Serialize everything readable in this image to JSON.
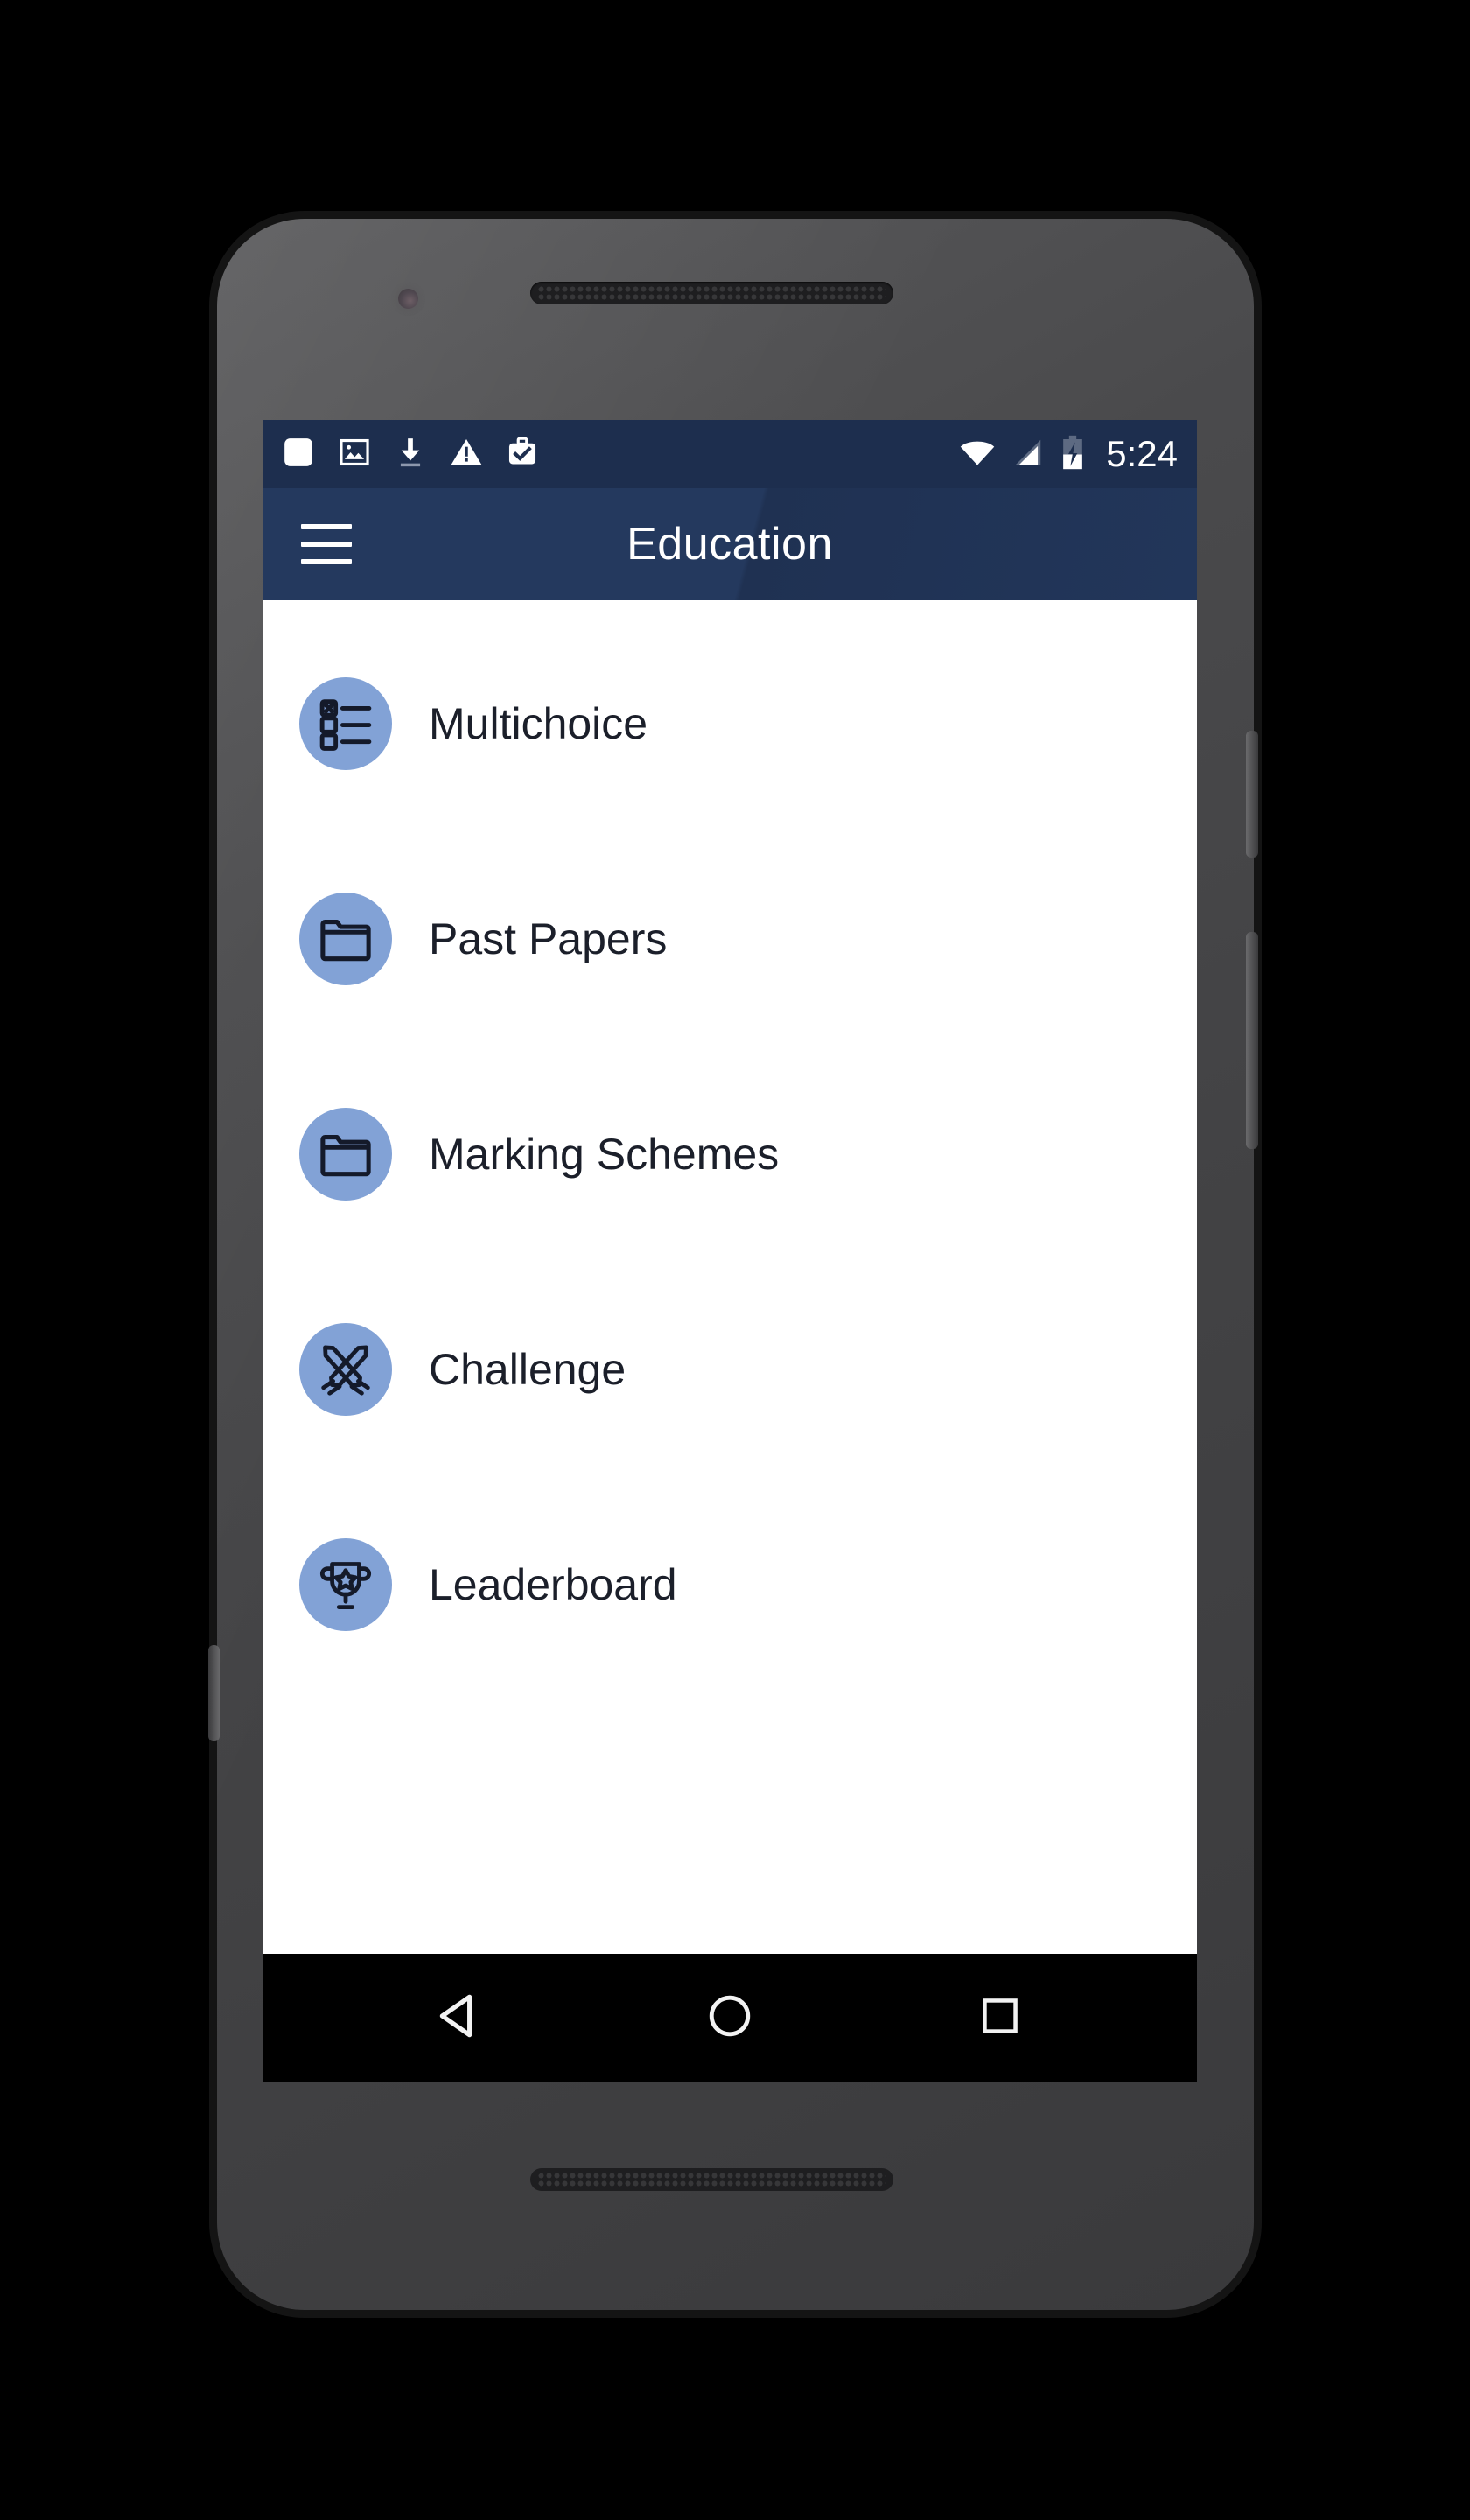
{
  "device": {
    "type": "android-phone",
    "body_color": "#4a4a4c"
  },
  "statusbar": {
    "background": "#1d2e4e",
    "left_icons": [
      {
        "name": "blank-notification-icon",
        "glyph": "rounded-square"
      },
      {
        "name": "image-notification-icon",
        "glyph": "photo"
      },
      {
        "name": "download-notification-icon",
        "glyph": "download-arrow"
      },
      {
        "name": "warning-notification-icon",
        "glyph": "warning-triangle"
      },
      {
        "name": "work-profile-icon",
        "glyph": "briefcase-check"
      }
    ],
    "right_icons": [
      {
        "name": "wifi-icon",
        "glyph": "wifi"
      },
      {
        "name": "cellular-signal-icon",
        "glyph": "signal-triangle"
      },
      {
        "name": "battery-charging-icon",
        "glyph": "battery-bolt"
      }
    ],
    "clock": "5:24"
  },
  "appbar": {
    "background": "#24395e",
    "menu_label": "Open navigation drawer",
    "title": "Education"
  },
  "list": {
    "background": "#ffffff",
    "avatar_color": "#82A2D6",
    "items": [
      {
        "label": "Multichoice",
        "icon": "checklist-icon"
      },
      {
        "label": "Past Papers",
        "icon": "folder-icon"
      },
      {
        "label": "Marking Schemes",
        "icon": "folder-icon"
      },
      {
        "label": "Challenge",
        "icon": "crossed-swords-icon"
      },
      {
        "label": "Leaderboard",
        "icon": "trophy-star-icon"
      }
    ]
  },
  "navbar": {
    "background": "#000000",
    "buttons": [
      {
        "name": "back-button",
        "icon": "back-triangle-icon"
      },
      {
        "name": "home-button",
        "icon": "home-circle-icon"
      },
      {
        "name": "recents-button",
        "icon": "recents-square-icon"
      }
    ]
  }
}
